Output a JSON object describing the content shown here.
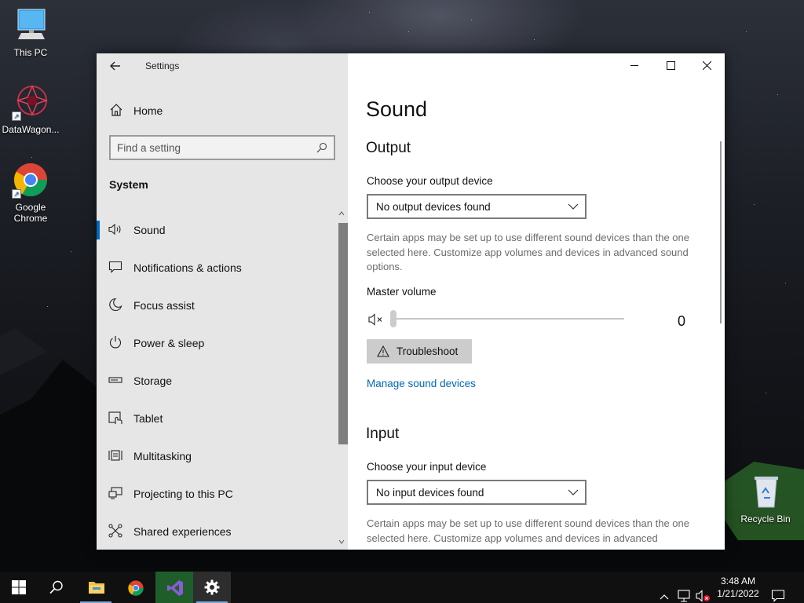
{
  "desktop": {
    "icons": [
      {
        "label": "This PC"
      },
      {
        "label": "DataWagon..."
      },
      {
        "label": "Google Chrome"
      },
      {
        "label": "Recycle Bin"
      }
    ]
  },
  "window": {
    "app_title": "Settings",
    "sidebar": {
      "home_label": "Home",
      "search_placeholder": "Find a setting",
      "section_title": "System",
      "items": [
        {
          "label": "Sound",
          "icon": "speaker-icon",
          "selected": true
        },
        {
          "label": "Notifications & actions",
          "icon": "notifications-icon"
        },
        {
          "label": "Focus assist",
          "icon": "moon-icon"
        },
        {
          "label": "Power & sleep",
          "icon": "power-icon"
        },
        {
          "label": "Storage",
          "icon": "storage-icon"
        },
        {
          "label": "Tablet",
          "icon": "tablet-icon"
        },
        {
          "label": "Multitasking",
          "icon": "multitasking-icon"
        },
        {
          "label": "Projecting to this PC",
          "icon": "projecting-icon"
        },
        {
          "label": "Shared experiences",
          "icon": "shared-experiences-icon"
        }
      ]
    },
    "content": {
      "page_title": "Sound",
      "output": {
        "heading": "Output",
        "device_label": "Choose your output device",
        "device_value": "No output devices found",
        "description": "Certain apps may be set up to use different sound devices than the one selected here. Customize app volumes and devices in advanced sound options.",
        "master_volume_label": "Master volume",
        "master_volume_value": "0",
        "troubleshoot_label": "Troubleshoot",
        "manage_link": "Manage sound devices"
      },
      "input": {
        "heading": "Input",
        "device_label": "Choose your input device",
        "device_value": "No input devices found",
        "description": "Certain apps may be set up to use different sound devices than the one selected here. Customize app volumes and devices in advanced"
      }
    }
  },
  "taskbar": {
    "clock_time": "3:48 AM",
    "clock_date": "1/21/2022"
  },
  "colors": {
    "accent": "#0067c0",
    "link": "#0067b8",
    "sidebar_bg": "#e6e6e6",
    "taskbar_bg": "#101010"
  }
}
